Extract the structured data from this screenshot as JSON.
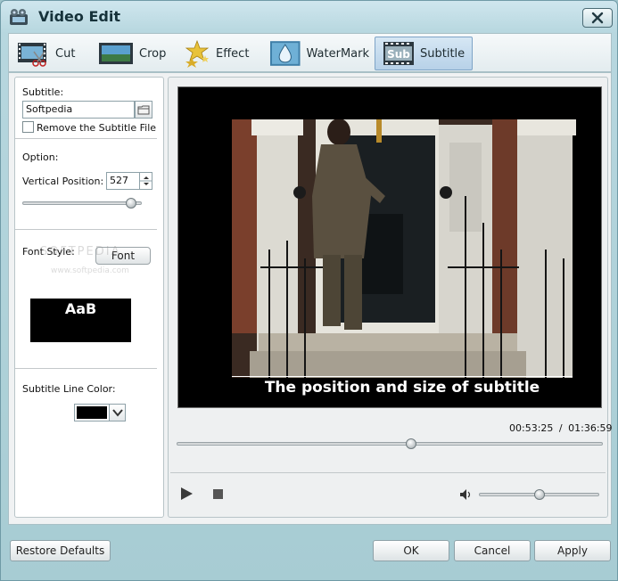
{
  "window": {
    "title": "Video Edit"
  },
  "tabs": [
    {
      "label": "Cut",
      "icon": "film-scissors-icon"
    },
    {
      "label": "Crop",
      "icon": "crop-frame-icon"
    },
    {
      "label": "Effect",
      "icon": "stars-icon"
    },
    {
      "label": "WaterMark",
      "icon": "water-drop-icon"
    },
    {
      "label": "Subtitle",
      "icon": "sub-film-icon",
      "icon_text": "Sub",
      "active": true
    }
  ],
  "subtitle_panel": {
    "subtitle_label": "Subtitle:",
    "subtitle_value": "Softpedia",
    "remove_label": "Remove the Subtitle File",
    "remove_checked": false,
    "option_label": "Option:",
    "vertical_position_label": "Vertical Position:",
    "vertical_position_value": "527",
    "vertical_slider_level": 0.91,
    "font_style_label": "Font Style:",
    "font_button_label": "Font",
    "font_preview_text": "AaB",
    "watermark_line1": "SOFTPEDIA",
    "watermark_line2": "www.softpedia.com",
    "line_color_label": "Subtitle Line Color:",
    "line_color_value": "#000000"
  },
  "player": {
    "subtitle_overlay": "The position and size of subtitle",
    "current_time": "00:53:25",
    "time_separator": "/",
    "total_time": "01:36:59",
    "progress_level": 0.55,
    "volume_level": 0.5
  },
  "footer": {
    "restore_label": "Restore Defaults",
    "ok_label": "OK",
    "cancel_label": "Cancel",
    "apply_label": "Apply"
  },
  "colors": {
    "accent": "#b7d1e8",
    "frame": "#a7ccd3"
  }
}
